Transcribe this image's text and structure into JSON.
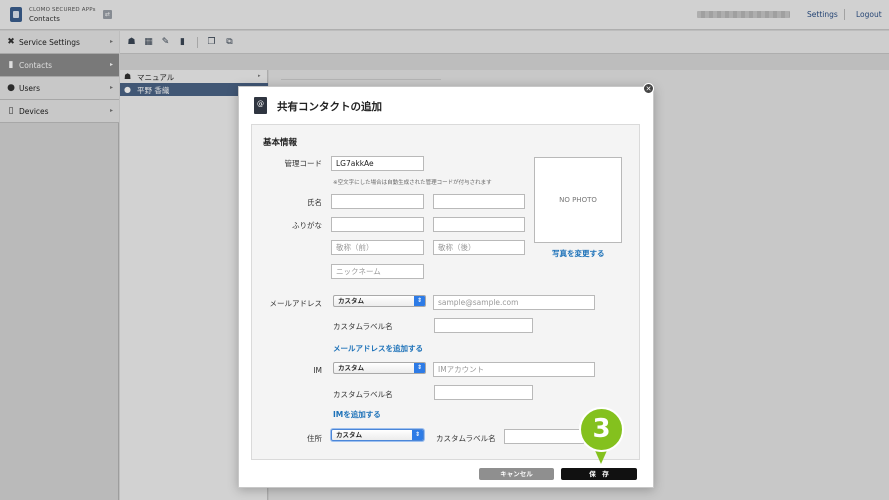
{
  "header": {
    "app_name_line1": "CLOMO SECURED APPs",
    "app_name_line2": "Contacts",
    "settings_label": "Settings",
    "logout_label": "Logout"
  },
  "sidebar": {
    "items": [
      {
        "label": "Service Settings",
        "icon": "wrench-icon"
      },
      {
        "label": "Contacts",
        "icon": "contacts-book-icon",
        "active": true
      },
      {
        "label": "Users",
        "icon": "user-icon"
      },
      {
        "label": "Devices",
        "icon": "device-icon"
      }
    ]
  },
  "toolbar": {
    "icons": [
      "add-user-icon",
      "add-contact-icon",
      "edit-icon",
      "trash-icon",
      "copy-icon",
      "move-icon"
    ]
  },
  "list": {
    "items": [
      {
        "label": "マニュアル",
        "icon": "group-icon"
      },
      {
        "label": "平野 香織",
        "icon": "person-icon",
        "selected": true
      }
    ]
  },
  "modal": {
    "title": "共有コンタクトの追加",
    "section_title": "基本情報",
    "fields": {
      "management_code_label": "管理コード",
      "management_code_value": "LG7akkAe",
      "management_code_note": "※空文字にした場合は自動生成された管理コードが付与されます",
      "name_label": "氏名",
      "furigana_label": "ふりがな",
      "honorific_first_placeholder": "敬称（前）",
      "honorific_last_placeholder": "敬称（後）",
      "nickname_placeholder": "ニックネーム",
      "photo_text": "NO PHOTO",
      "change_photo_link": "写真を変更する",
      "email_label": "メールアドレス",
      "email_type": "カスタム",
      "email_placeholder": "sample@sample.com",
      "custom_label_text": "カスタムラベル名",
      "add_email_link": "メールアドレスを追加する",
      "im_label": "IM",
      "im_type": "カスタム",
      "im_placeholder": "IMアカウント",
      "add_im_link": "IMを追加する",
      "address_label": "住所",
      "address_type": "カスタム"
    },
    "cancel_label": "キャンセル",
    "save_label": "保　存"
  },
  "annotation": {
    "step_number": "3",
    "badge_color": "#84c11e"
  },
  "colors": {
    "accent_link": "#1a70b8",
    "selected_row": "#4b6587",
    "active_nav": "#8c8c8c"
  }
}
